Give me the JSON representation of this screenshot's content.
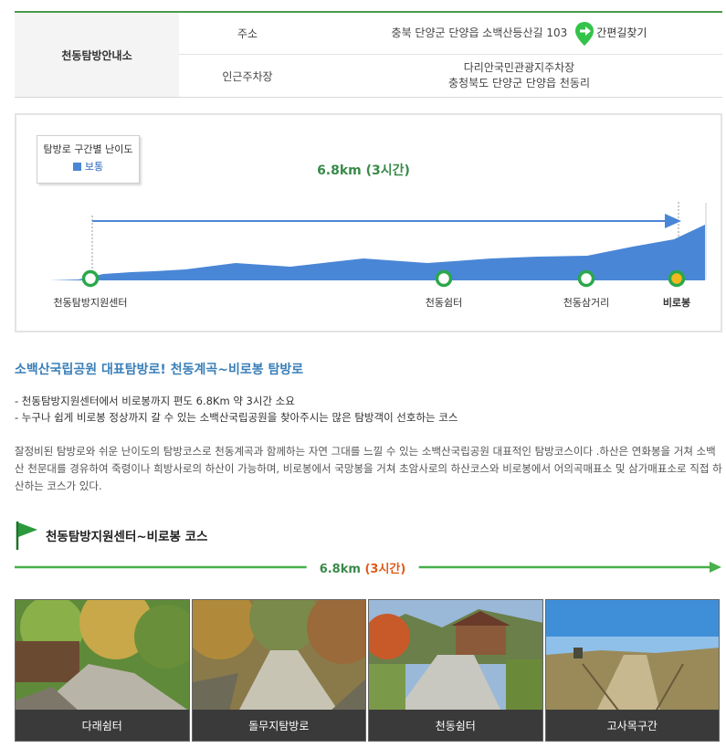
{
  "info": {
    "heading": "천동탐방안내소",
    "rows": [
      {
        "key": "주소",
        "value": "충북 단양군 단양읍 소백산등산길 103",
        "link": "간편길찾기"
      },
      {
        "key": "인근주차장",
        "lines": [
          "다리안국민관광지주차장",
          "충청북도 단양군 단양읍 천동리"
        ]
      }
    ]
  },
  "chart": {
    "legend_title": "탐방로 구간별 난이도",
    "legend_item": "보통",
    "distance": "6.8km (3시간)",
    "colors": {
      "area": "#4a86d6",
      "arrow": "#4a86d6",
      "point": "#2aa84a",
      "end": "#f0b81e"
    },
    "points": [
      {
        "label": "천동탐방지원센터",
        "bold": false
      },
      {
        "label": "천동쉼터",
        "bold": false
      },
      {
        "label": "천동삼거리",
        "bold": false
      },
      {
        "label": "비로봉",
        "bold": true
      }
    ]
  },
  "description": {
    "title": "소백산국립공원 대표탐방로! 천동계곡~비로봉 탐방로",
    "bullets": [
      "- 천동탐방지원센터에서 비로봉까지 편도 6.8Km 약 3시간 소요",
      "- 누구나 쉽게 비로봉 정상까지 갈 수 있는 소백산국립공원을 찾아주시는 많은 탐방객이 선호하는 코스"
    ],
    "paragraph": "잘정비된 탐방로와 쉬운 난이도의 탐방코스로 천동계곡과 함께하는 자연 그대를 느낄 수 있는 소백산국립공원 대표적인 탐방코스이다 .하산은 연화봉을 거쳐 소백산 천문대를 경유하여 죽령이나 희방사로의 하산이 가능하며, 비로봉에서 국망봉을 거쳐 초암사로의 하산코스와 비로봉에서 어의곡매표소 및 삼가매표소로 직접 하산하는 코스가 있다."
  },
  "course": {
    "title": "천동탐방지원센터~비로봉 코스",
    "distance": "6.8km",
    "time": "(3시간)",
    "photos": [
      {
        "caption": "다래쉼터"
      },
      {
        "caption": "돌무지탐방로"
      },
      {
        "caption": "천동쉼터"
      },
      {
        "caption": "고사목구간"
      }
    ]
  }
}
